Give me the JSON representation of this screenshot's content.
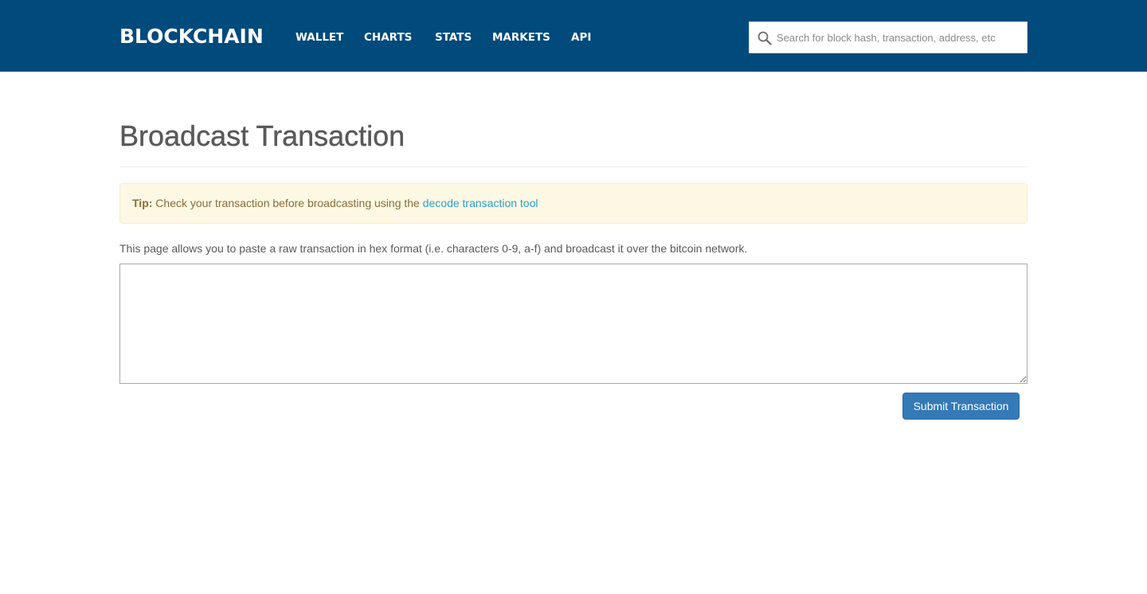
{
  "header": {
    "logo": "BLOCKCHAIN",
    "nav": [
      {
        "label": "WALLET"
      },
      {
        "label": "CHARTS"
      },
      {
        "label": "STATS"
      },
      {
        "label": "MARKETS"
      },
      {
        "label": "API"
      }
    ],
    "search": {
      "placeholder": "Search for block hash, transaction, address, etc",
      "value": "",
      "icon": "search-icon"
    }
  },
  "main": {
    "title": "Broadcast Transaction",
    "tip": {
      "label": "Tip:",
      "text": " Check your transaction before broadcasting using the ",
      "link": "decode transaction tool"
    },
    "description": "This page allows you to paste a raw transaction in hex format (i.e. characters 0-9, a-f) and broadcast it over the bitcoin network.",
    "textarea_value": "",
    "submit_label": "Submit Transaction"
  },
  "colors": {
    "header_bg": "#004a7c",
    "tip_bg": "#fcf8e3",
    "tip_text": "#8a6d3b",
    "link": "#2a9fd6",
    "button_bg": "#337ab7",
    "title_text": "#595959"
  }
}
